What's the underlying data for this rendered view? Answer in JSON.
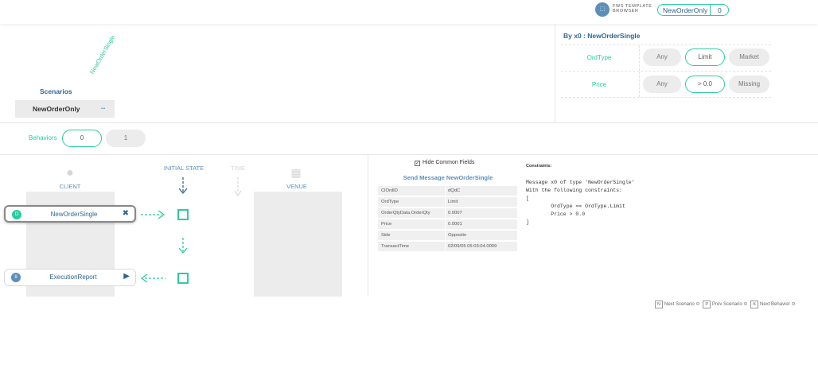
{
  "header": {
    "logo_icon": "fws-logo-icon",
    "logo_text": "FWS TEMPLATE BROWSER",
    "current_scenario": "NewOrderOnly",
    "current_behavior": "0"
  },
  "scenarios": {
    "title": "Scenarios",
    "column_label": "NewOrderSingle",
    "rows": [
      {
        "name": "NewOrderOnly",
        "marker": "•••"
      }
    ]
  },
  "filters": {
    "title": "By x0 : NewOrderSingle",
    "groups": [
      {
        "label": "OrdType",
        "options": [
          "Any",
          "Limit",
          "Market"
        ],
        "selected": "Limit"
      },
      {
        "label": "Price",
        "options": [
          "Any",
          "> 0.0",
          "Missing"
        ],
        "selected": "> 0.0"
      }
    ]
  },
  "behaviors": {
    "label": "Behaviors",
    "options": [
      "0",
      "1"
    ],
    "selected": "0"
  },
  "sequence": {
    "client_label": "CLIENT",
    "initial_state_label": "INITIAL STATE",
    "time_label": "TIME",
    "venue_label": "VENUE",
    "messages": [
      {
        "name": "NewOrderSingle",
        "badge": "D",
        "badge_color": "#2bcca0",
        "action": "✖"
      },
      {
        "name": "ExecutionReport",
        "badge": "8",
        "badge_color": "#5b8fb9",
        "action": "▶"
      }
    ]
  },
  "detail": {
    "hide_common_label": "Hide Common Fields",
    "hide_common_checked": true,
    "title": "Send Message NewOrderSingle",
    "fields": [
      {
        "key": "ClOrdID",
        "value": "dQdC"
      },
      {
        "key": "OrdType",
        "value": "Limit"
      },
      {
        "key": "OrderQtyData.OrderQty",
        "value": "0.0007"
      },
      {
        "key": "Price",
        "value": "0.0001"
      },
      {
        "key": "Side",
        "value": "Opposite"
      },
      {
        "key": "TransactTime",
        "value": "02/09/05 05:03:04.0009"
      }
    ]
  },
  "constraints": {
    "title": "Constraints:",
    "code": "Message x0 of type 'NewOrderSingle'\nWith the following constraints:\n[\n        OrdType == OrdType.Limit\n        Price > 0.0\n]"
  },
  "shortcuts": [
    {
      "key": "N",
      "label": "Next Scenario"
    },
    {
      "key": "P",
      "label": "Prev Scenario"
    },
    {
      "key": "K",
      "label": "Next Behavior"
    }
  ],
  "colors": {
    "accent": "#2bcca0",
    "primary": "#2f6690",
    "secondary": "#5b8fb9"
  }
}
